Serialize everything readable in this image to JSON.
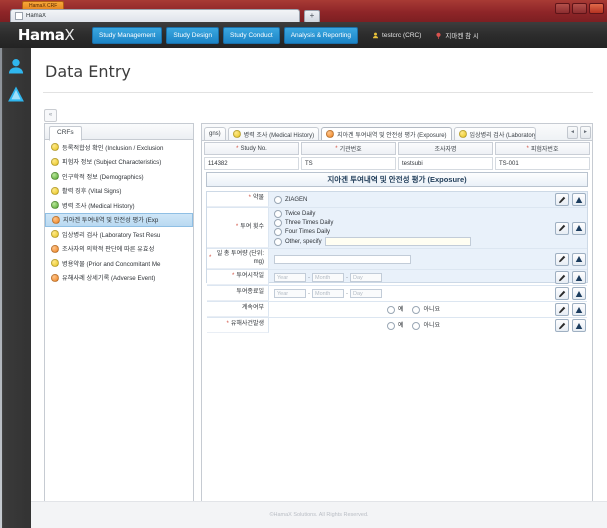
{
  "browser": {
    "app_tab_label": "HamaX CRF",
    "tab_title": "HamaX",
    "newtab_label": "+",
    "window_buttons": [
      "minimize",
      "maximize",
      "close"
    ]
  },
  "topnav": {
    "brand_main": "Hama",
    "brand_accent": "X",
    "buttons": [
      {
        "label": "Study Management"
      },
      {
        "label": "Study Design"
      },
      {
        "label": "Study Conduct"
      },
      {
        "label": "Analysis & Reporting"
      }
    ],
    "user": "testcrc (CRC)",
    "secondary": "지마켄 참 시",
    "accent_color": "#1c84c6",
    "bar_color": "#2c2c2c"
  },
  "rail": {
    "items": [
      {
        "name": "user-icon"
      },
      {
        "name": "alert-icon"
      }
    ]
  },
  "page": {
    "title": "Data Entry",
    "collapse_label": "«"
  },
  "crf_panel": {
    "tab_label": "CRFs",
    "items": [
      {
        "dot": "y",
        "label": "등록적합성 확인 (Inclusion / Exclusion"
      },
      {
        "dot": "y",
        "label": "피험자 정보 (Subject Characteristics)"
      },
      {
        "dot": "g",
        "label": "인구학적 정보 (Demographics)"
      },
      {
        "dot": "y",
        "label": "활력 징후 (Vital Signs)"
      },
      {
        "dot": "g",
        "label": "병력 조사 (Medical History)"
      },
      {
        "dot": "o",
        "label": "지아겐 투여내역 및 안전성 평가 (Exp"
      },
      {
        "dot": "y",
        "label": "임상병리 검사 (Laboratory Test Resu"
      },
      {
        "dot": "o",
        "label": "조사자의 의학적 판단에 따른 유효성"
      },
      {
        "dot": "y",
        "label": "병용약물 (Prior and Concomitant Me"
      },
      {
        "dot": "o",
        "label": "유해사례 상세기록 (Adverse Event)"
      }
    ],
    "selected_index": 5,
    "scroll_left_label": "◄",
    "scroll_right_label": "►"
  },
  "ecrf": {
    "tabs": [
      {
        "label": "gns)",
        "dot": "",
        "active": false
      },
      {
        "label": "병력 조사 (Medical History)",
        "dot": "y",
        "active": false
      },
      {
        "label": "지아겐 투여내역 및 안전성 평가 (Exposure)",
        "dot": "o",
        "active": true
      },
      {
        "label": "임상병리 검사 (Laboratory Test",
        "dot": "y",
        "active": false
      }
    ],
    "nav_prev": "◄",
    "nav_next": "►",
    "header_columns": [
      {
        "label": "Study No.",
        "required": true,
        "value": "114382"
      },
      {
        "label": "기관번호",
        "required": true,
        "value": "TS"
      },
      {
        "label": "조사자명",
        "required": false,
        "value": "testsubi"
      },
      {
        "label": "피험자번호",
        "required": true,
        "value": "TS-001"
      }
    ],
    "form_title": "지아겐 투여내역 및 안전성 평가 (Exposure)",
    "rows": [
      {
        "label": "약물",
        "required": true,
        "type": "radio",
        "options": [
          "ZIAGEN"
        ]
      },
      {
        "label": "투여 횟수",
        "required": true,
        "type": "radio-other",
        "options": [
          "Twice Daily",
          "Three Times Daily",
          "Four Times Daily"
        ],
        "other_label": "Other, specify",
        "other_value": ""
      },
      {
        "label": "일 총 투여량 (단위: mg)",
        "required": true,
        "type": "text",
        "value": ""
      },
      {
        "label": "투여시작일",
        "required": true,
        "type": "date",
        "year_placeholder": "Year",
        "month_placeholder": "Month",
        "day_placeholder": "Day",
        "separator": "-"
      },
      {
        "label": "투여종료일",
        "required": false,
        "type": "date",
        "year_placeholder": "Year",
        "month_placeholder": "Month",
        "day_placeholder": "Day",
        "separator": "-"
      },
      {
        "label": "계속여부",
        "required": false,
        "type": "radio",
        "options": [
          "예",
          "아니요"
        ]
      },
      {
        "label": "유해사건발생",
        "required": true,
        "type": "radio",
        "options": [
          "예",
          "아니요"
        ]
      }
    ],
    "row_actions": [
      {
        "name": "edit-icon"
      },
      {
        "name": "flag-icon"
      }
    ],
    "bottom_buttons": [
      {
        "name": "document-icon"
      },
      {
        "name": "save-icon"
      }
    ]
  },
  "footer": {
    "text": "©HamaX Solutions. All Rights Reserved."
  }
}
